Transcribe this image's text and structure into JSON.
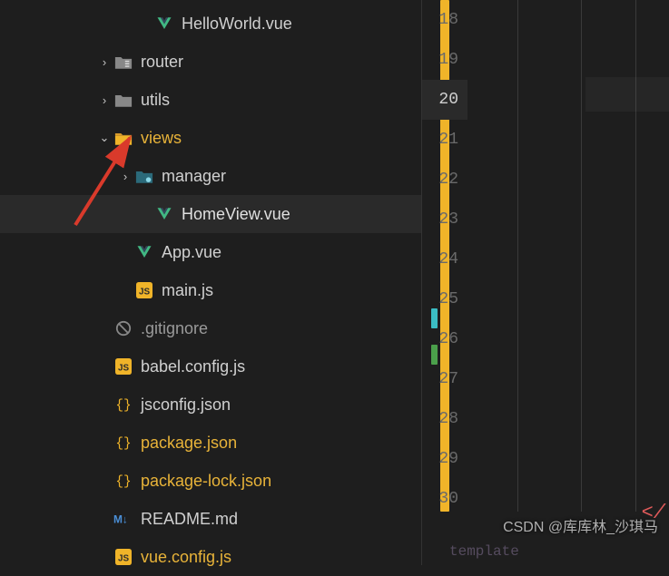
{
  "tree": [
    {
      "indent": 150,
      "chevron": "none",
      "icon": "vue",
      "label": "HelloWorld.vue",
      "cls": ""
    },
    {
      "indent": 105,
      "chevron": "right",
      "icon": "folder-router",
      "label": "router",
      "cls": ""
    },
    {
      "indent": 105,
      "chevron": "right",
      "icon": "folder-utils",
      "label": "utils",
      "cls": ""
    },
    {
      "indent": 105,
      "chevron": "down",
      "icon": "folder-views",
      "label": "views",
      "cls": "highlight"
    },
    {
      "indent": 128,
      "chevron": "right",
      "icon": "folder-manager",
      "label": "manager",
      "cls": ""
    },
    {
      "indent": 150,
      "chevron": "none",
      "icon": "vue",
      "label": "HomeView.vue",
      "cls": "active",
      "selected": true
    },
    {
      "indent": 128,
      "chevron": "none",
      "icon": "vue",
      "label": "App.vue",
      "cls": ""
    },
    {
      "indent": 128,
      "chevron": "none",
      "icon": "js",
      "label": "main.js",
      "cls": ""
    },
    {
      "indent": 105,
      "chevron": "none",
      "icon": "gitignore",
      "label": ".gitignore",
      "cls": "muted"
    },
    {
      "indent": 105,
      "chevron": "none",
      "icon": "js",
      "label": "babel.config.js",
      "cls": ""
    },
    {
      "indent": 105,
      "chevron": "none",
      "icon": "json",
      "label": "jsconfig.json",
      "cls": ""
    },
    {
      "indent": 105,
      "chevron": "none",
      "icon": "json",
      "label": "package.json",
      "cls": "highlight"
    },
    {
      "indent": 105,
      "chevron": "none",
      "icon": "json",
      "label": "package-lock.json",
      "cls": "highlight"
    },
    {
      "indent": 105,
      "chevron": "none",
      "icon": "md",
      "label": "README.md",
      "cls": ""
    },
    {
      "indent": 105,
      "chevron": "none",
      "icon": "js",
      "label": "vue.config.js",
      "cls": "highlight"
    }
  ],
  "lineNumbers": [
    "18",
    "19",
    "20",
    "21",
    "22",
    "23",
    "24",
    "25",
    "26",
    "27",
    "28",
    "29",
    "30"
  ],
  "activeLine": "20",
  "bottomHints": [
    "template"
  ],
  "closeTag": "</",
  "watermark": "CSDN @库库林_沙琪马"
}
